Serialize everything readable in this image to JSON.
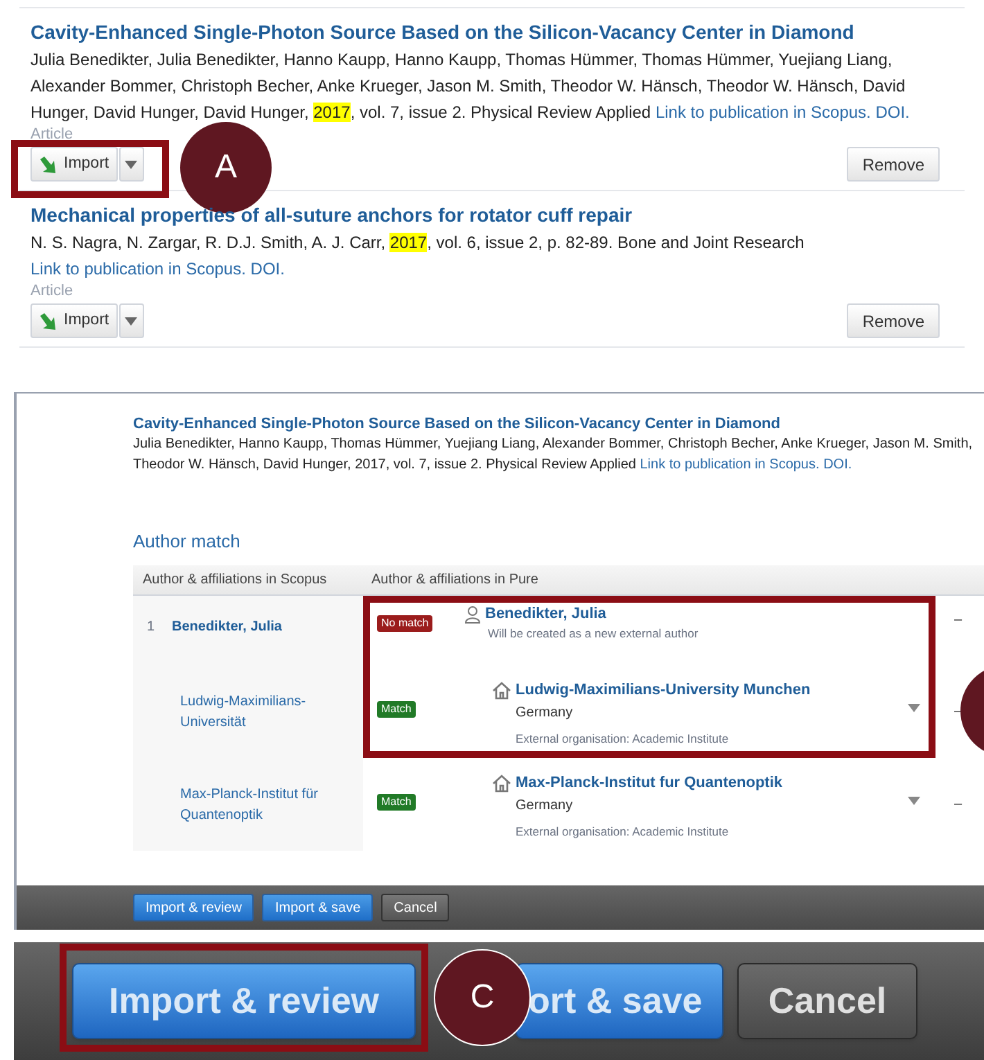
{
  "publication_list": {
    "entries": [
      {
        "title": "Cavity-Enhanced Single-Photon Source Based on the Silicon-Vacancy Center in Diamond",
        "authors": "Julia Benedikter, Julia Benedikter, Hanno Kaupp, Hanno Kaupp, Thomas Hümmer, Thomas Hümmer, Yuejiang Liang, Alexander Bommer, Christoph Becher, Anke Krueger, Jason M. Smith, Theodor W. Hänsch, Theodor W. Hänsch, David Hunger, David Hunger, David Hunger, ",
        "year": "2017",
        "details": ", vol. 7, issue 2. Physical Review Applied ",
        "links": [
          "Link to publication in Scopus.",
          "DOI."
        ],
        "type": "Article",
        "import_label": "Import",
        "remove_label": "Remove",
        "highlighted": true,
        "callout": "A"
      },
      {
        "title": "Mechanical properties of all-suture anchors for rotator cuff repair",
        "authors": "N. S. Nagra, N. Zargar, R. D.J. Smith, A. J. Carr, ",
        "year": "2017",
        "details": ", vol. 6, issue 2, p. 82-89. Bone and Joint Research ",
        "links": [
          "Link to publication in Scopus.",
          "DOI."
        ],
        "type": "Article",
        "import_label": "Import",
        "remove_label": "Remove",
        "highlighted": false
      }
    ]
  },
  "import_preview": {
    "title": "Cavity-Enhanced Single-Photon Source Based on the Silicon-Vacancy Center in Diamond",
    "citation": "Julia Benedikter, Hanno Kaupp, Thomas Hümmer, Yuejiang Liang, Alexander Bommer, Christoph Becher, Anke Krueger, Jason M. Smith, Theodor W. Hänsch, David Hunger, 2017, vol. 7, issue 2. Physical Review Applied ",
    "links": [
      "Link to publication in Scopus.",
      "DOI."
    ],
    "author_match": {
      "heading": "Author match",
      "columns": [
        "Author & affiliations in Scopus",
        "Author & affiliations in Pure"
      ],
      "rows": [
        {
          "kind": "person",
          "number": "1",
          "scopus": "Benedikter, Julia",
          "matched": false,
          "status": "No match",
          "pure_name": "Benedikter, Julia",
          "note": "Will be created as a new external author",
          "action": "–",
          "highlighted": true
        },
        {
          "kind": "organisation",
          "scopus": "Ludwig-Maximilians-Universität",
          "matched": true,
          "status": "Match",
          "pure_name": "Ludwig-Maximilians-University Munchen",
          "country": "Germany",
          "note": "External organisation: Academic Institute",
          "action": "–",
          "highlighted": true
        },
        {
          "kind": "organisation",
          "scopus": "Max-Planck-Institut für Quantenoptik",
          "matched": true,
          "status": "Match",
          "pure_name": "Max-Planck-Institut fur Quantenoptik",
          "country": "Germany",
          "note": "External organisation: Academic Institute",
          "action": "–",
          "highlighted": false
        }
      ]
    },
    "buttons": [
      {
        "label": "Import & review",
        "kind": "primary"
      },
      {
        "label": "Import & save",
        "kind": "primary"
      },
      {
        "label": "Cancel",
        "kind": "secondary"
      }
    ]
  },
  "zoomed_buttons": {
    "callout": "C",
    "buttons": [
      {
        "label": "Import & review",
        "kind": "primary",
        "highlighted": true
      },
      {
        "label": "ort & save",
        "kind": "primary",
        "highlighted": false
      },
      {
        "label": "Cancel",
        "kind": "secondary",
        "highlighted": false
      }
    ]
  }
}
